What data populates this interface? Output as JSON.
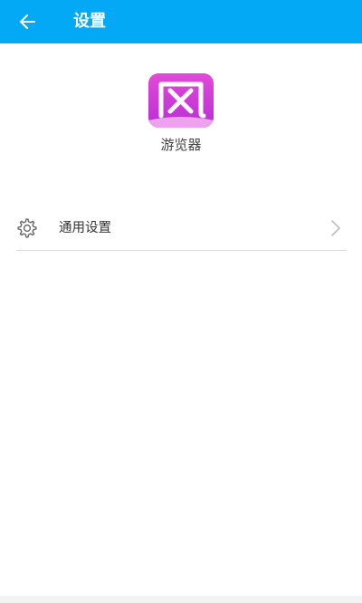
{
  "header": {
    "title": "设置",
    "back_icon": "arrow-left-icon",
    "background_color": "#03a9f4"
  },
  "app": {
    "name": "游览器",
    "logo_glyph": "风",
    "logo_color": "#d63fd8"
  },
  "settings": {
    "items": [
      {
        "label": "通用设置",
        "icon": "gear-icon",
        "trailing_icon": "chevron-right-icon"
      }
    ]
  }
}
